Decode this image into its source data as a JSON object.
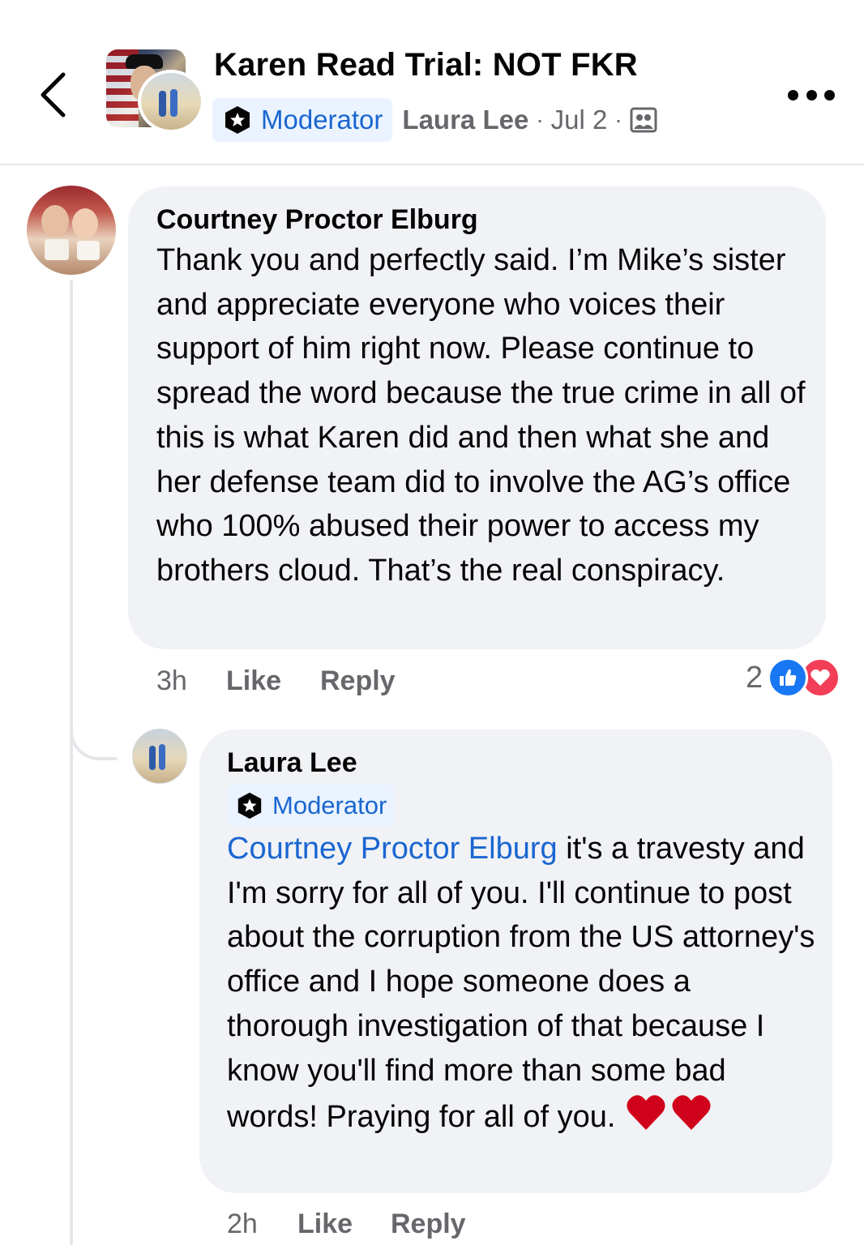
{
  "header": {
    "group_name": "Karen Read Trial:  NOT FKR",
    "moderator_badge": "Moderator",
    "author": "Laura Lee",
    "separator": "·",
    "date": "Jul 2",
    "privacy_icon": "group-privacy-icon"
  },
  "comments": [
    {
      "author": "Courtney Proctor Elburg",
      "text": "Thank you and perfectly said. I’m Mike’s sister and appreciate everyone who voices their support of him right now. Please continue to spread the word because the true crime in all of this is what Karen did and then what she and her defense team did to involve the AG’s office who 100% abused their power to access my brothers cloud. That’s the real conspiracy.",
      "time": "3h",
      "like_label": "Like",
      "reply_label": "Reply",
      "reaction_count": "2",
      "reactions": [
        "like-reaction-icon",
        "love-reaction-icon"
      ]
    },
    {
      "author": "Laura Lee",
      "badge": "Moderator",
      "mention": "Courtney Proctor Elburg",
      "text": " it's a travesty and I'm sorry for all of you. I'll continue to post about the corruption from the US attorney's office and I hope someone does a thorough investigation of that because I know you'll find more than some bad words! Praying for all of you.",
      "trailing_emoji": "heart-emoji x2",
      "time": "2h",
      "like_label": "Like",
      "reply_label": "Reply"
    }
  ],
  "colors": {
    "accent_blue": "#1a66d1",
    "bubble_bg": "#f0f2f5",
    "muted_text": "#65676b",
    "like_blue": "#1877f2",
    "love_red": "#f33e58"
  }
}
